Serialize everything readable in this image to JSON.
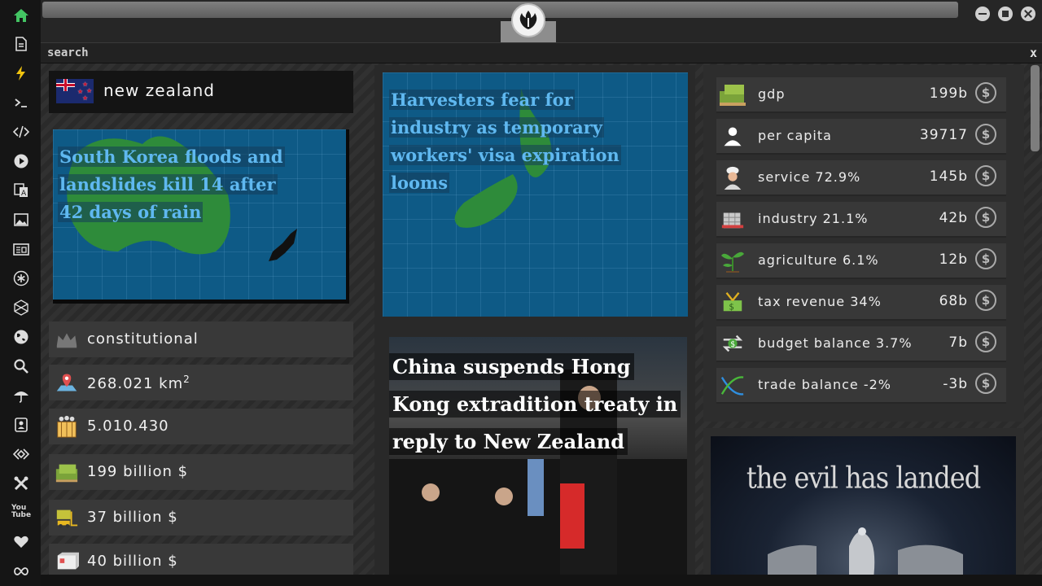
{
  "sidebar": {
    "icons": [
      "home-icon",
      "document-icon",
      "bolt-icon",
      "terminal-icon",
      "code-icon",
      "play-icon",
      "translate-icon",
      "image-icon",
      "newspaper-icon",
      "asterisk-icon",
      "hexagon-icon",
      "globe-icon",
      "search-icon",
      "umbrella-icon",
      "contact-icon",
      "api-icon",
      "tools-icon",
      "youtube-icon",
      "heart-icon",
      "infinity-icon"
    ],
    "youtube_label": "You Tube"
  },
  "search": {
    "label": "search",
    "close": "x"
  },
  "country": {
    "name": "new zealand"
  },
  "news": [
    {
      "headline": "South Korea floods and landslides kill 14 after 42 days of rain"
    },
    {
      "headline": "Harvesters fear for industry as temporary workers' visa expiration looms"
    },
    {
      "headline": "China suspends Hong Kong extradition treaty in reply to New Zealand"
    }
  ],
  "info": {
    "government": "constitutional",
    "area_value": "268.021 km",
    "area_sup": "2",
    "population": "5.010.430",
    "gdp": "199 billion $",
    "budget": "37 billion $",
    "trade": "40 billion $"
  },
  "economy": [
    {
      "label": "gdp",
      "value": "199b",
      "icon": "money-icon"
    },
    {
      "label": "per capita",
      "value": "39717",
      "icon": "person-icon"
    },
    {
      "label": "service 72.9%",
      "value": "145b",
      "icon": "chef-icon"
    },
    {
      "label": "industry 21.1%",
      "value": "42b",
      "icon": "factory-icon"
    },
    {
      "label": "agriculture 6.1%",
      "value": "12b",
      "icon": "plant-icon"
    },
    {
      "label": "tax revenue 34%",
      "value": "68b",
      "icon": "tax-icon"
    },
    {
      "label": "budget balance 3.7%",
      "value": "7b",
      "icon": "exchange-icon"
    },
    {
      "label": "trade balance -2%",
      "value": "-3b",
      "icon": "trade-icon"
    }
  ],
  "currency_symbol": "$",
  "ad": {
    "title": "the evil has landed"
  }
}
